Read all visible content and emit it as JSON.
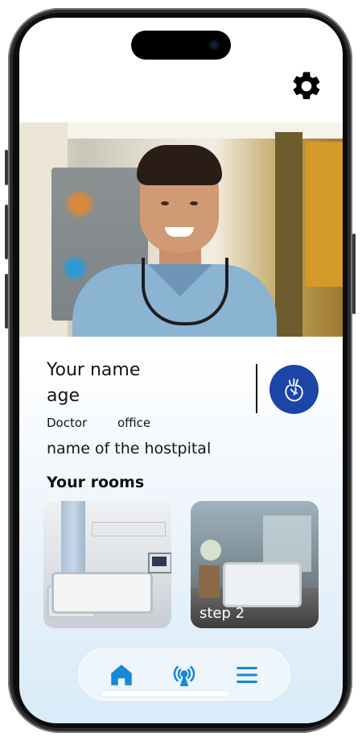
{
  "profile": {
    "name": "Your name",
    "age": "age",
    "role": "Doctor",
    "office": "office",
    "hospital": "name of the hostpital"
  },
  "rooms": {
    "title": "Your rooms",
    "items": [
      {
        "label": ""
      },
      {
        "label": "step 2"
      }
    ]
  },
  "nav": {
    "items": [
      "home-icon",
      "broadcast-icon",
      "menu-icon"
    ]
  },
  "colors": {
    "accent": "#1b45a6",
    "nav_icon": "#1688d8"
  }
}
